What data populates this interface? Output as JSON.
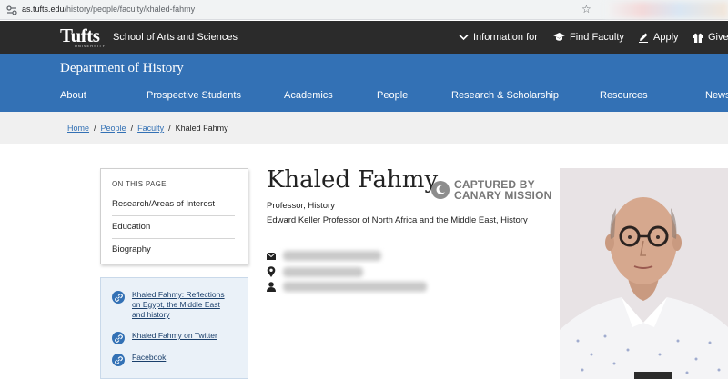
{
  "browser": {
    "url_host": "as.tufts.edu",
    "url_path": "/history/people/faculty/khaled-fahmy"
  },
  "topbar": {
    "logo": "Tufts",
    "logo_sub": "UNIVERSITY",
    "school": "School of Arts and Sciences",
    "nav": [
      {
        "label": "Information for",
        "icon": "chevron-down-icon"
      },
      {
        "label": "Find Faculty",
        "icon": "graduation-cap-icon"
      },
      {
        "label": "Apply",
        "icon": "pencil-icon"
      },
      {
        "label": "Give",
        "icon": "gift-icon"
      }
    ]
  },
  "dept": {
    "title": "Department of History",
    "menu": [
      "About",
      "Prospective Students",
      "Academics",
      "People",
      "Research & Scholarship",
      "Resources",
      "News"
    ]
  },
  "breadcrumb": {
    "items": [
      "Home",
      "People",
      "Faculty"
    ],
    "current": "Khaled Fahmy",
    "separator": "/"
  },
  "on_this_page": {
    "heading": "ON THIS PAGE",
    "items": [
      "Research/Areas of Interest",
      "Education",
      "Biography"
    ]
  },
  "links": [
    "Khaled Fahmy: Reflections on Egypt, the Middle East and history",
    "Khaled Fahmy on Twitter",
    "Facebook"
  ],
  "profile": {
    "name": "Khaled Fahmy",
    "title": "Professor, History",
    "chair": "Edward Keller Professor of North Africa and the Middle East, History",
    "captured_line1": "CAPTURED BY",
    "captured_line2": "CANARY MISSION"
  },
  "colors": {
    "brand_blue": "#3371b5",
    "top_bar": "#2b2b2b",
    "crumb_bg": "#f0f0f0"
  }
}
